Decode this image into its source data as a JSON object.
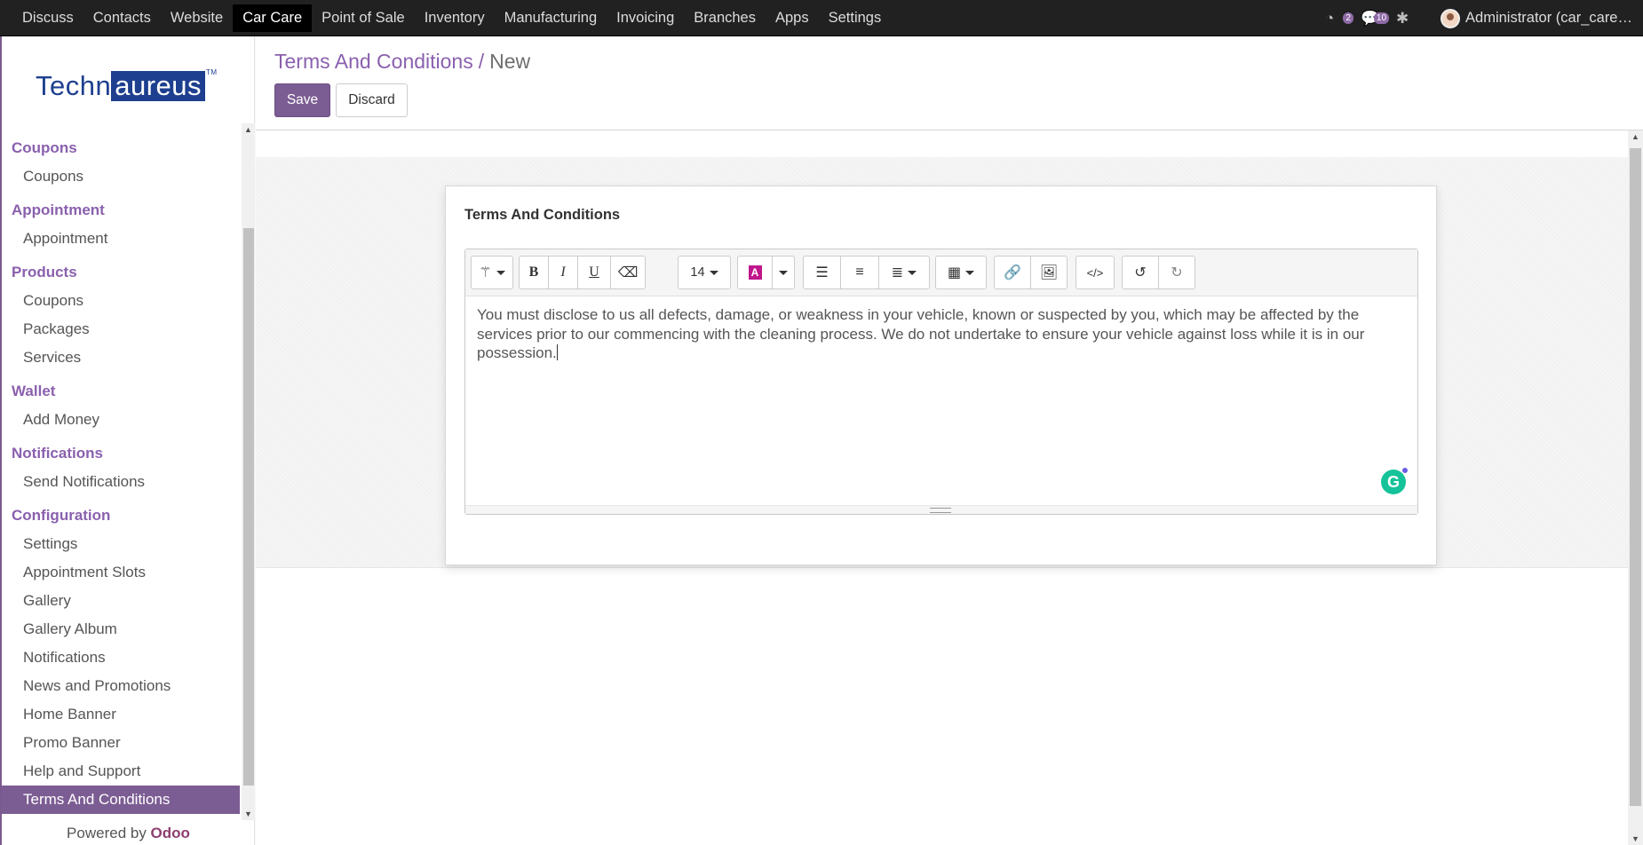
{
  "topnav": {
    "items": [
      "Discuss",
      "Contacts",
      "Website",
      "Car Care",
      "Point of Sale",
      "Inventory",
      "Manufacturing",
      "Invoicing",
      "Branches",
      "Apps",
      "Settings"
    ],
    "active": "Car Care",
    "activity_count": "2",
    "message_count": "10",
    "user_name": "Administrator (car_care…"
  },
  "sidebar": {
    "logo_part1": "Techn",
    "logo_part2": "aureus",
    "logo_tm": "TM",
    "sections": [
      {
        "title": "Coupons",
        "items": [
          "Coupons"
        ]
      },
      {
        "title": "Appointment",
        "items": [
          "Appointment"
        ]
      },
      {
        "title": "Products",
        "items": [
          "Coupons",
          "Packages",
          "Services"
        ]
      },
      {
        "title": "Wallet",
        "items": [
          "Add Money"
        ]
      },
      {
        "title": "Notifications",
        "items": [
          "Send Notifications"
        ]
      },
      {
        "title": "Configuration",
        "items": [
          "Settings",
          "Appointment Slots",
          "Gallery",
          "Gallery Album",
          "Notifications",
          "News and Promotions",
          "Home Banner",
          "Promo Banner",
          "Help and Support",
          "Terms And Conditions"
        ]
      }
    ],
    "active_item": "Terms And Conditions",
    "powered_prefix": "Powered by ",
    "powered_brand": "Odoo"
  },
  "control": {
    "breadcrumb_parent": "Terms And Conditions",
    "breadcrumb_sep": "/",
    "breadcrumb_current": "New",
    "save_label": "Save",
    "discard_label": "Discard"
  },
  "form": {
    "field_label": "Terms And Conditions",
    "font_size": "14",
    "color_letter": "A",
    "body_text": "You must disclose to us all defects, damage, or weakness in your vehicle, known or suspected by you, which may be affected by the services prior to our commencing with the cleaning process. We do not undertake to ensure your vehicle against loss while it is in our possession.",
    "grammarly_letter": "G"
  },
  "colors": {
    "brand": "#7c5d93",
    "nav_bg": "#212121",
    "logo_blue": "#1e3f8f"
  }
}
